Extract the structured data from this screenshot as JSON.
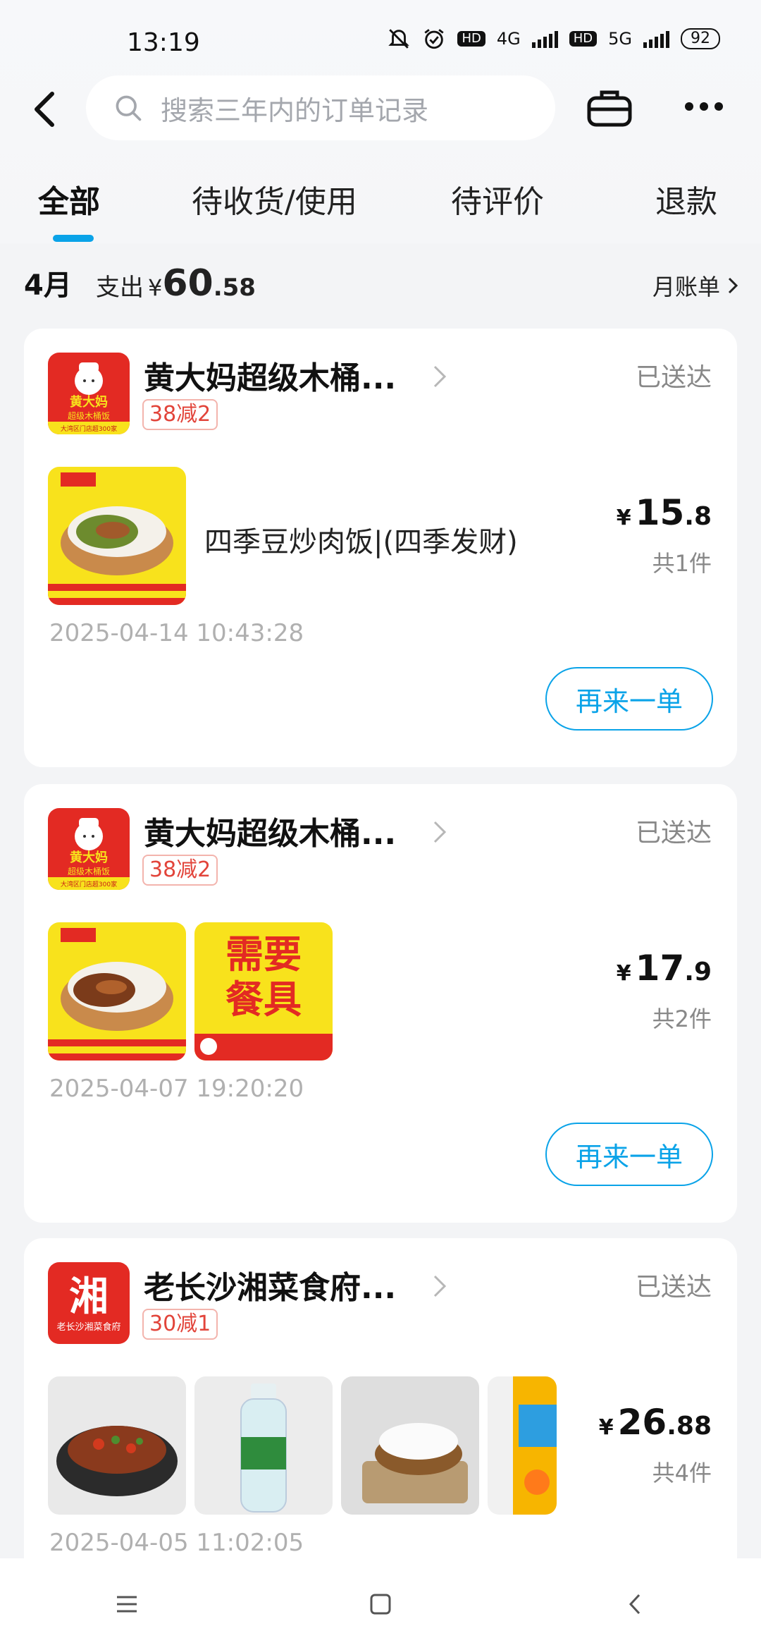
{
  "status": {
    "time": "13:19",
    "hd": "HD",
    "net1": "4G",
    "net2": "5G",
    "battery": "92"
  },
  "search": {
    "placeholder": "搜索三年内的订单记录"
  },
  "tabs": [
    {
      "label": "全部"
    },
    {
      "label": "待收货/使用"
    },
    {
      "label": "待评价"
    },
    {
      "label": "退款"
    }
  ],
  "summary": {
    "month": "4月",
    "spend_label": "支出",
    "currency": "¥",
    "amount_int": "60",
    "amount_dec": ".58",
    "bill_link": "月账单"
  },
  "orders": [
    {
      "store": "黄大妈超级木桶...",
      "promo": "38减2",
      "status": "已送达",
      "item_name": "四季豆炒肉饭|(四季发财)",
      "currency": "¥",
      "price_int": "15",
      "price_dec": ".8",
      "qty": "共1件",
      "date": "2025-04-14 10:43:28",
      "action": "再来一单"
    },
    {
      "store": "黄大妈超级木桶...",
      "promo": "38减2",
      "status": "已送达",
      "item_name": "",
      "currency": "¥",
      "price_int": "17",
      "price_dec": ".9",
      "qty": "共2件",
      "date": "2025-04-07 19:20:20",
      "action": "再来一单",
      "sticker_text_top": "需要",
      "sticker_text_bottom": "餐具"
    },
    {
      "store": "老长沙湘菜食府...",
      "promo": "30减1",
      "status": "已送达",
      "item_name": "",
      "currency": "¥",
      "price_int": "26",
      "price_dec": ".88",
      "qty": "共4件",
      "date": "2025-04-05 11:02:05"
    }
  ],
  "logos": {
    "brand1_line1": "黄大妈",
    "brand1_line2": "超级木桶饭",
    "brand1_line3": "大湾区门店超300家",
    "brand2_char": "湘",
    "brand2_line": "老长沙湘菜食府"
  },
  "colors": {
    "accent": "#0aa3e8",
    "promo": "#e2443a",
    "logo_red": "#e32a23",
    "logo_yellow": "#f8e21c"
  }
}
